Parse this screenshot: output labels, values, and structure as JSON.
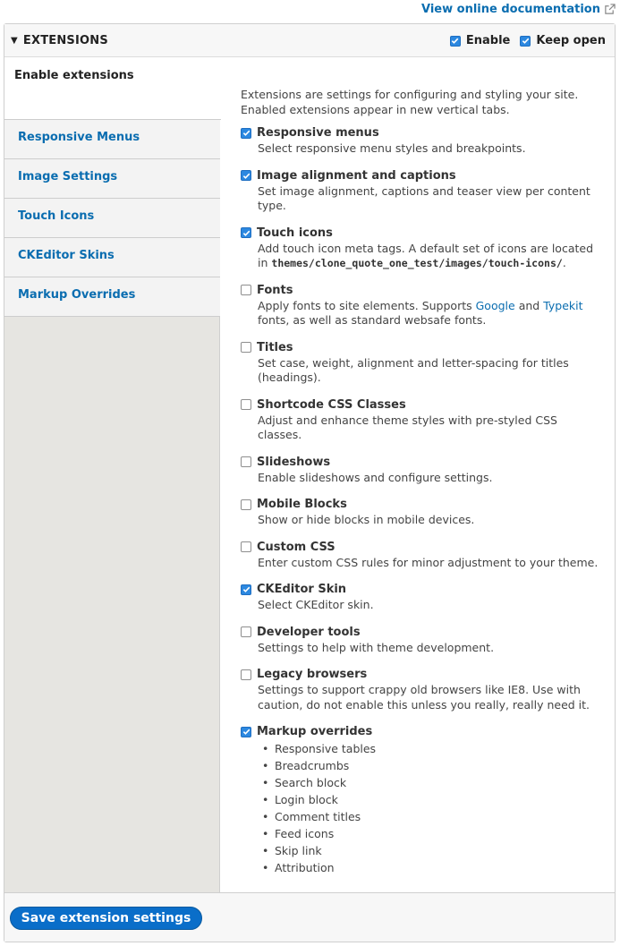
{
  "doc_link": {
    "label": "View online documentation",
    "icon": "external-link-icon"
  },
  "panel": {
    "title": "EXTENSIONS",
    "toggle_icon": "triangle-down-icon",
    "enable": {
      "label": "Enable",
      "checked": true
    },
    "keep_open": {
      "label": "Keep open",
      "checked": true
    }
  },
  "tabs": [
    {
      "label": "Enable extensions",
      "active": true
    },
    {
      "label": "Responsive Menus"
    },
    {
      "label": "Image Settings"
    },
    {
      "label": "Touch Icons"
    },
    {
      "label": "CKEditor Skins"
    },
    {
      "label": "Markup Overrides"
    }
  ],
  "content": {
    "intro": "Extensions are settings for configuring and styling your site. Enabled extensions appear in new vertical tabs.",
    "items": [
      {
        "label": "Responsive menus",
        "checked": true,
        "desc": "Select responsive menu styles and breakpoints."
      },
      {
        "label": "Image alignment and captions",
        "checked": true,
        "desc": "Set image alignment, captions and teaser view per content type."
      },
      {
        "label": "Touch icons",
        "checked": true,
        "desc": "Add touch icon meta tags. A default set of icons are located in",
        "code": "themes/clone_quote_one_test/images/touch-icons/",
        "desc_end": "."
      },
      {
        "label": "Fonts",
        "checked": false,
        "desc": "Apply fonts to site elements. Supports",
        "link1": "Google",
        "mid": "and",
        "link2": "Typekit",
        "desc_end": "fonts, as well as standard websafe fonts."
      },
      {
        "label": "Titles",
        "checked": false,
        "desc": "Set case, weight, alignment and letter-spacing for titles (headings)."
      },
      {
        "label": "Shortcode CSS Classes",
        "checked": false,
        "desc": "Adjust and enhance theme styles with pre-styled CSS classes."
      },
      {
        "label": "Slideshows",
        "checked": false,
        "desc": "Enable slideshows and configure settings."
      },
      {
        "label": "Mobile Blocks",
        "checked": false,
        "desc": "Show or hide blocks in mobile devices."
      },
      {
        "label": "Custom CSS",
        "checked": false,
        "desc": "Enter custom CSS rules for minor adjustment to your theme."
      },
      {
        "label": "CKEditor Skin",
        "checked": true,
        "desc": "Select CKEditor skin."
      },
      {
        "label": "Developer tools",
        "checked": false,
        "desc": "Settings to help with theme development."
      },
      {
        "label": "Legacy browsers",
        "checked": false,
        "desc": "Settings to support crappy old browsers like IE8. Use with caution, do not enable this unless you really, really need it."
      },
      {
        "label": "Markup overrides",
        "checked": true,
        "list": [
          "Responsive tables",
          "Breadcrumbs",
          "Search block",
          "Login block",
          "Comment titles",
          "Feed icons",
          "Skip link",
          "Attribution"
        ]
      }
    ]
  },
  "footer": {
    "save_label": "Save extension settings"
  },
  "colors": {
    "accent": "#0a6db0",
    "checkbox_on": "#2c88e0",
    "button": "#0a6ec9",
    "tabs_bg": "#e6e5e1"
  }
}
